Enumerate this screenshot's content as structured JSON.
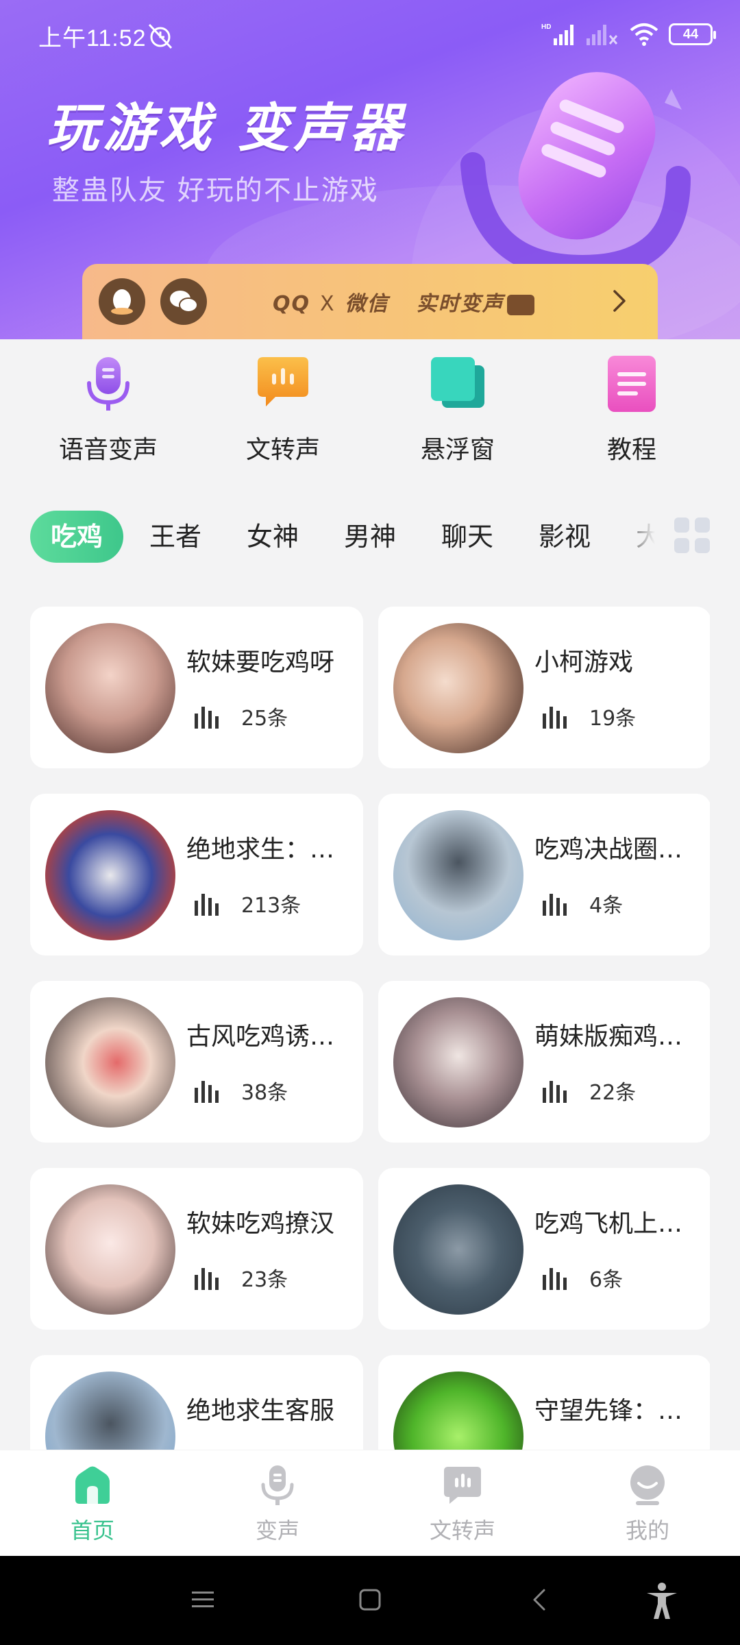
{
  "status_bar": {
    "time": "上午11:52",
    "battery": "44"
  },
  "banner": {
    "title": "玩游戏  变声器",
    "subtitle": "整蛊队友 好玩的不止游戏",
    "promo": {
      "qq": "QQ",
      "x": "X",
      "wechat": "微信",
      "realtime": "实时变声"
    }
  },
  "features": [
    {
      "label": "语音变声",
      "icon": "microphone-icon",
      "color": "#9b5cf0"
    },
    {
      "label": "文转声",
      "icon": "chat-bubble-icon",
      "color": "#f7a233"
    },
    {
      "label": "悬浮窗",
      "icon": "windows-icon",
      "color": "#2cc7b0"
    },
    {
      "label": "教程",
      "icon": "document-icon",
      "color": "#f063c8"
    }
  ],
  "tabs": [
    "吃鸡",
    "王者",
    "女神",
    "男神",
    "聊天",
    "影视",
    "大"
  ],
  "active_tab": "吃鸡",
  "cards": [
    {
      "title": "软妹要吃鸡呀",
      "count": "25条"
    },
    {
      "title": "小柯游戏",
      "count": "19条"
    },
    {
      "title": "绝地求生：…",
      "count": "213条"
    },
    {
      "title": "吃鸡决战圈…",
      "count": "4条"
    },
    {
      "title": "古风吃鸡诱…",
      "count": "38条"
    },
    {
      "title": "萌妹版痴鸡…",
      "count": "22条"
    },
    {
      "title": "软妹吃鸡撩汉",
      "count": "23条"
    },
    {
      "title": "吃鸡飞机上…",
      "count": "6条"
    },
    {
      "title": "绝地求生客服",
      "count": ""
    },
    {
      "title": "守望先锋：…",
      "count": ""
    }
  ],
  "bottom_nav": [
    {
      "label": "首页",
      "icon": "home-icon",
      "active": true
    },
    {
      "label": "变声",
      "icon": "microphone-icon",
      "active": false
    },
    {
      "label": "文转声",
      "icon": "text-to-speech-icon",
      "active": false
    },
    {
      "label": "我的",
      "icon": "profile-icon",
      "active": false
    }
  ],
  "colors": {
    "accent": "#38c28d",
    "banner": "#9a6cf5",
    "promo": "#f7c37a"
  }
}
